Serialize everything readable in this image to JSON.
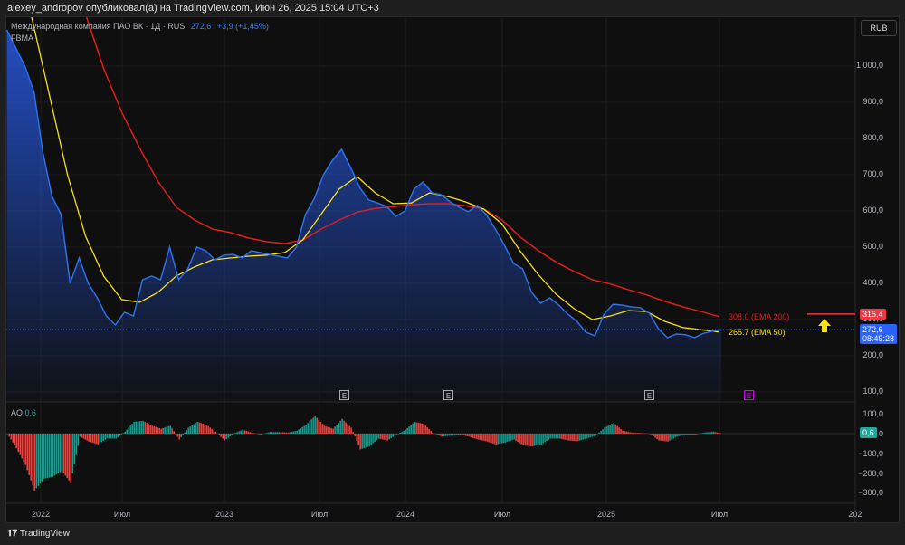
{
  "header": {
    "text": "alexey_andropov опубликовал(а) на TradingView.com, Июн 26, 2025 15:04 UTC+3"
  },
  "legend": {
    "symbol": "Международная компания ПАО ВК · 1Д · RUS",
    "price": "272,6",
    "change": "+3,9 (+1,45%)",
    "indicator": "FBMA"
  },
  "currency_button": "RUB",
  "ao_legend": {
    "name": "AO",
    "value": "0,6"
  },
  "price_axis": [
    "1 000,0",
    "900,0",
    "800,0",
    "700,0",
    "600,0",
    "500,0",
    "400,0",
    "300,0",
    "200,0",
    "100,0"
  ],
  "ao_axis": [
    "100,0",
    "0",
    "−100,0",
    "−200,0",
    "−300,0"
  ],
  "x_axis": [
    "2022",
    "Июл",
    "2023",
    "Июл",
    "2024",
    "Июл",
    "2025",
    "Июл",
    "202"
  ],
  "tags": {
    "ema200_price": "315,4",
    "last_price": "272,6",
    "countdown": "08:45:28",
    "ao_value": "0,6",
    "ema200_label": "308.0 (EMA 200)",
    "ema50_label": "265.7 (EMA 50)"
  },
  "earnings": [
    "E",
    "E",
    "E",
    "E"
  ],
  "footer": "TradingView",
  "colors": {
    "price": "#2f6fe8",
    "ema50": "#f5e21b",
    "ema200": "#e01e1e",
    "ao_up": "#26a69a",
    "ao_down": "#ef5350"
  },
  "chart_data": {
    "type": "line",
    "x_unit": "decimal year",
    "price": {
      "start": 2021.82,
      "step": 0.048,
      "values": [
        1100,
        1050,
        1000,
        930,
        760,
        640,
        590,
        400,
        470,
        400,
        360,
        310,
        285,
        320,
        310,
        410,
        420,
        410,
        500,
        410,
        440,
        500,
        490,
        465,
        478,
        480,
        470,
        490,
        485,
        480,
        475,
        470,
        500,
        590,
        635,
        700,
        740,
        770,
        720,
        665,
        630,
        622,
        612,
        585,
        600,
        660,
        680,
        650,
        645,
        625,
        610,
        598,
        615,
        590,
        550,
        505,
        455,
        440,
        375,
        345,
        360,
        340,
        315,
        295,
        265,
        255,
        315,
        342,
        340,
        335,
        333,
        318,
        275,
        250,
        260,
        258,
        250,
        262,
        268,
        272.6
      ]
    },
    "ema200": {
      "start": 2022.24,
      "step": 0.096,
      "values": [
        1140,
        990,
        870,
        770,
        680,
        610,
        575,
        550,
        540,
        525,
        515,
        510,
        520,
        550,
        575,
        597,
        607,
        612,
        617,
        620,
        620,
        614,
        605,
        575,
        528,
        490,
        458,
        432,
        410,
        398,
        382,
        368,
        350,
        335,
        322,
        308
      ]
    },
    "ema50": {
      "start": 2021.95,
      "step": 0.096,
      "values": [
        1140,
        920,
        700,
        530,
        420,
        355,
        348,
        375,
        420,
        445,
        465,
        470,
        475,
        478,
        485,
        520,
        590,
        660,
        695,
        650,
        620,
        622,
        650,
        640,
        625,
        605,
        565,
        490,
        425,
        370,
        330,
        300,
        310,
        325,
        322,
        295,
        278,
        272,
        265.7
      ]
    },
    "ao": {
      "start": 2021.82,
      "step": 0.048,
      "values": [
        0,
        -75,
        -160,
        -290,
        -230,
        -220,
        -190,
        -250,
        -15,
        -40,
        -55,
        -25,
        -25,
        10,
        60,
        65,
        40,
        25,
        40,
        -30,
        30,
        60,
        45,
        10,
        -35,
        0,
        20,
        5,
        -5,
        8,
        8,
        5,
        15,
        45,
        90,
        40,
        25,
        75,
        30,
        -80,
        -65,
        -25,
        -35,
        -5,
        20,
        60,
        50,
        5,
        -15,
        -10,
        -5,
        -15,
        -30,
        -40,
        -55,
        -45,
        -30,
        -60,
        -65,
        -55,
        -25,
        -25,
        -35,
        -38,
        -25,
        -10,
        30,
        55,
        15,
        5,
        3,
        0,
        -35,
        -40,
        -15,
        -5,
        -5,
        5,
        10,
        0.6
      ]
    },
    "price_ylim": [
      100,
      1000
    ],
    "ao_ylim": [
      -300,
      100
    ],
    "xlim": [
      2021.82,
      2026.0
    ]
  }
}
